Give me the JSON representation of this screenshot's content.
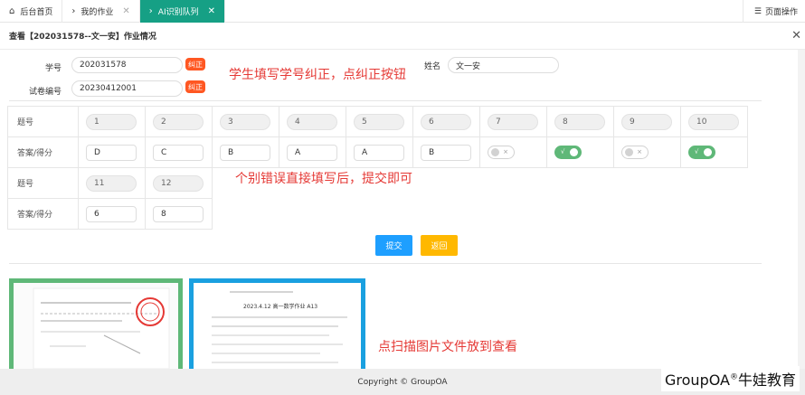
{
  "tabs": [
    {
      "label": "后台首页",
      "icon": "home-icon",
      "closable": false
    },
    {
      "label": "我的作业",
      "icon": "chevron-right-icon",
      "closable": true
    },
    {
      "label": "AI识别队列",
      "icon": "chevron-right-icon",
      "closable": true,
      "active": true
    }
  ],
  "tab_ops": {
    "label": "页面操作",
    "icon": "menu-icon"
  },
  "panel": {
    "title": "查看【202031578--文一安】作业情况"
  },
  "form": {
    "student_no_label": "学号",
    "student_no_value": "202031578",
    "paper_no_label": "试卷编号",
    "paper_no_value": "20230412001",
    "fix_label": "纠正",
    "name_label": "姓名",
    "name_value": "文一安"
  },
  "notes": {
    "note1": "学生填写学号纠正，点纠正按钮",
    "note2": "个别错误直接填写后，提交即可",
    "note3": "点扫描图片文件放到查看"
  },
  "table": {
    "q_label": "题号",
    "a_label": "答案/得分",
    "row1_numbers": [
      "1",
      "2",
      "3",
      "4",
      "5",
      "6",
      "7",
      "8",
      "9",
      "10"
    ],
    "row1_answers": [
      "D",
      "C",
      "B",
      "A",
      "A",
      "B"
    ],
    "row1_switches": [
      {
        "state": "off",
        "mark": "×"
      },
      {
        "state": "on",
        "mark": "√"
      },
      {
        "state": "off",
        "mark": "×"
      },
      {
        "state": "on",
        "mark": "√"
      }
    ],
    "row2_numbers": [
      "11",
      "12"
    ],
    "row2_answers": [
      "6",
      "8"
    ]
  },
  "buttons": {
    "submit": "提交",
    "back": "返回"
  },
  "footer": {
    "copyright": "Copyright © GroupOA"
  },
  "brand": {
    "name": "GroupOA",
    "reg": "®",
    "suffix": "牛娃教育"
  },
  "thumbnails": {
    "doc2_title": "2023.4.12 高一数学作业 A13"
  }
}
